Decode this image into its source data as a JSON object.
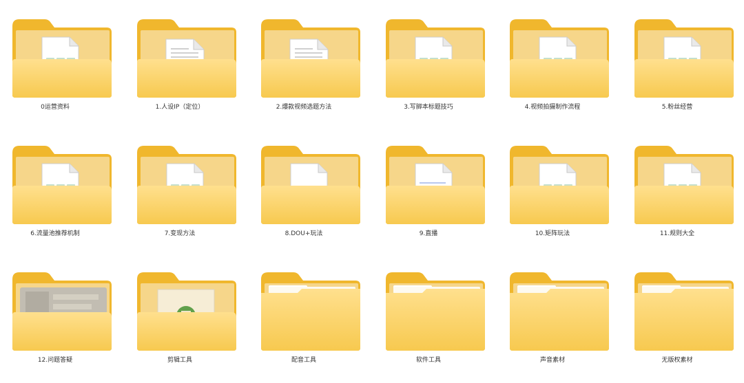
{
  "explorer": {
    "folders": [
      {
        "label": "0运营资料",
        "preview": "document-green",
        "icon": "folder-icon"
      },
      {
        "label": "1.人设IP（定位）",
        "preview": "document-red",
        "icon": "folder-icon"
      },
      {
        "label": "2.爆款视频选题方法",
        "preview": "document-red",
        "icon": "folder-icon"
      },
      {
        "label": "3.写脚本标题技巧",
        "preview": "document-green",
        "icon": "folder-icon"
      },
      {
        "label": "4.视频拍摄制作流程",
        "preview": "document-green",
        "icon": "folder-icon"
      },
      {
        "label": "5.粉丝经营",
        "preview": "document-green",
        "icon": "folder-icon"
      },
      {
        "label": "6.流量池推荐机制",
        "preview": "document-green",
        "icon": "folder-icon"
      },
      {
        "label": "7.变现方法",
        "preview": "document-green",
        "icon": "folder-icon"
      },
      {
        "label": "8.DOU+玩法",
        "preview": "document-plain",
        "icon": "folder-icon"
      },
      {
        "label": "9.直播",
        "preview": "document-lines",
        "icon": "folder-icon"
      },
      {
        "label": "10.矩阵玩法",
        "preview": "document-green",
        "icon": "folder-icon"
      },
      {
        "label": "11.规则大全",
        "preview": "document-green",
        "icon": "folder-icon"
      },
      {
        "label": "12.问题答疑",
        "preview": "blurred-image",
        "icon": "folder-icon"
      },
      {
        "label": "剪辑工具",
        "preview": "image-green",
        "icon": "folder-icon"
      },
      {
        "label": "配音工具",
        "preview": "paper",
        "icon": "folder-icon"
      },
      {
        "label": "软件工具",
        "preview": "paper",
        "icon": "folder-icon"
      },
      {
        "label": "声音素材",
        "preview": "paper",
        "icon": "folder-icon"
      },
      {
        "label": "无版权素材",
        "preview": "paper",
        "icon": "folder-icon"
      }
    ],
    "colors": {
      "folder_back": "#f0b72d",
      "folder_front_top": "#ffe08e",
      "folder_front_bottom": "#f7c94f",
      "green_accent": "#7cb98e",
      "red_accent": "#d32020",
      "label_text": "#333333"
    }
  }
}
